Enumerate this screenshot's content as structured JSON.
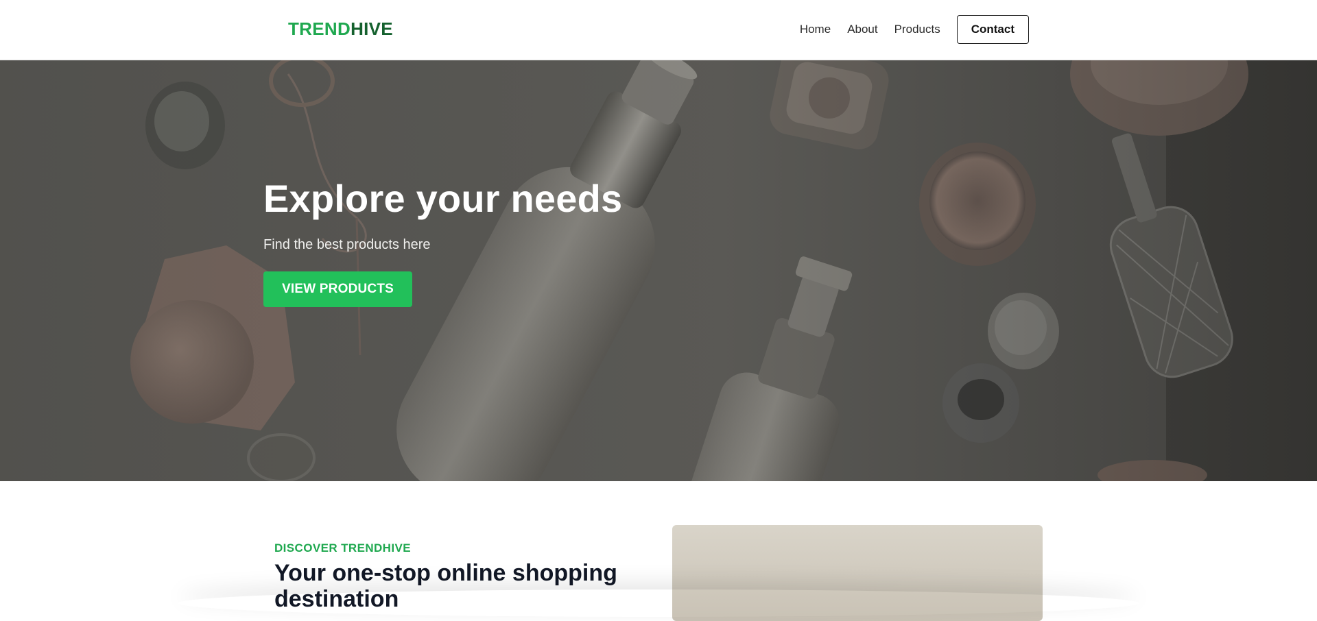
{
  "header": {
    "logo_part_a": "TREND",
    "logo_part_b": "HIVE",
    "nav": [
      "Home",
      "About",
      "Products"
    ],
    "contact_label": "Contact"
  },
  "hero": {
    "title": "Explore your needs",
    "subtitle": "Find the best products here",
    "cta_label": "VIEW PRODUCTS"
  },
  "discover": {
    "eyebrow": "DISCOVER TRENDHIVE",
    "title": "Your one-stop online shopping destination"
  },
  "colors": {
    "brand_green": "#22c05a",
    "brand_dark_green": "#15612e",
    "text_dark": "#121826"
  }
}
